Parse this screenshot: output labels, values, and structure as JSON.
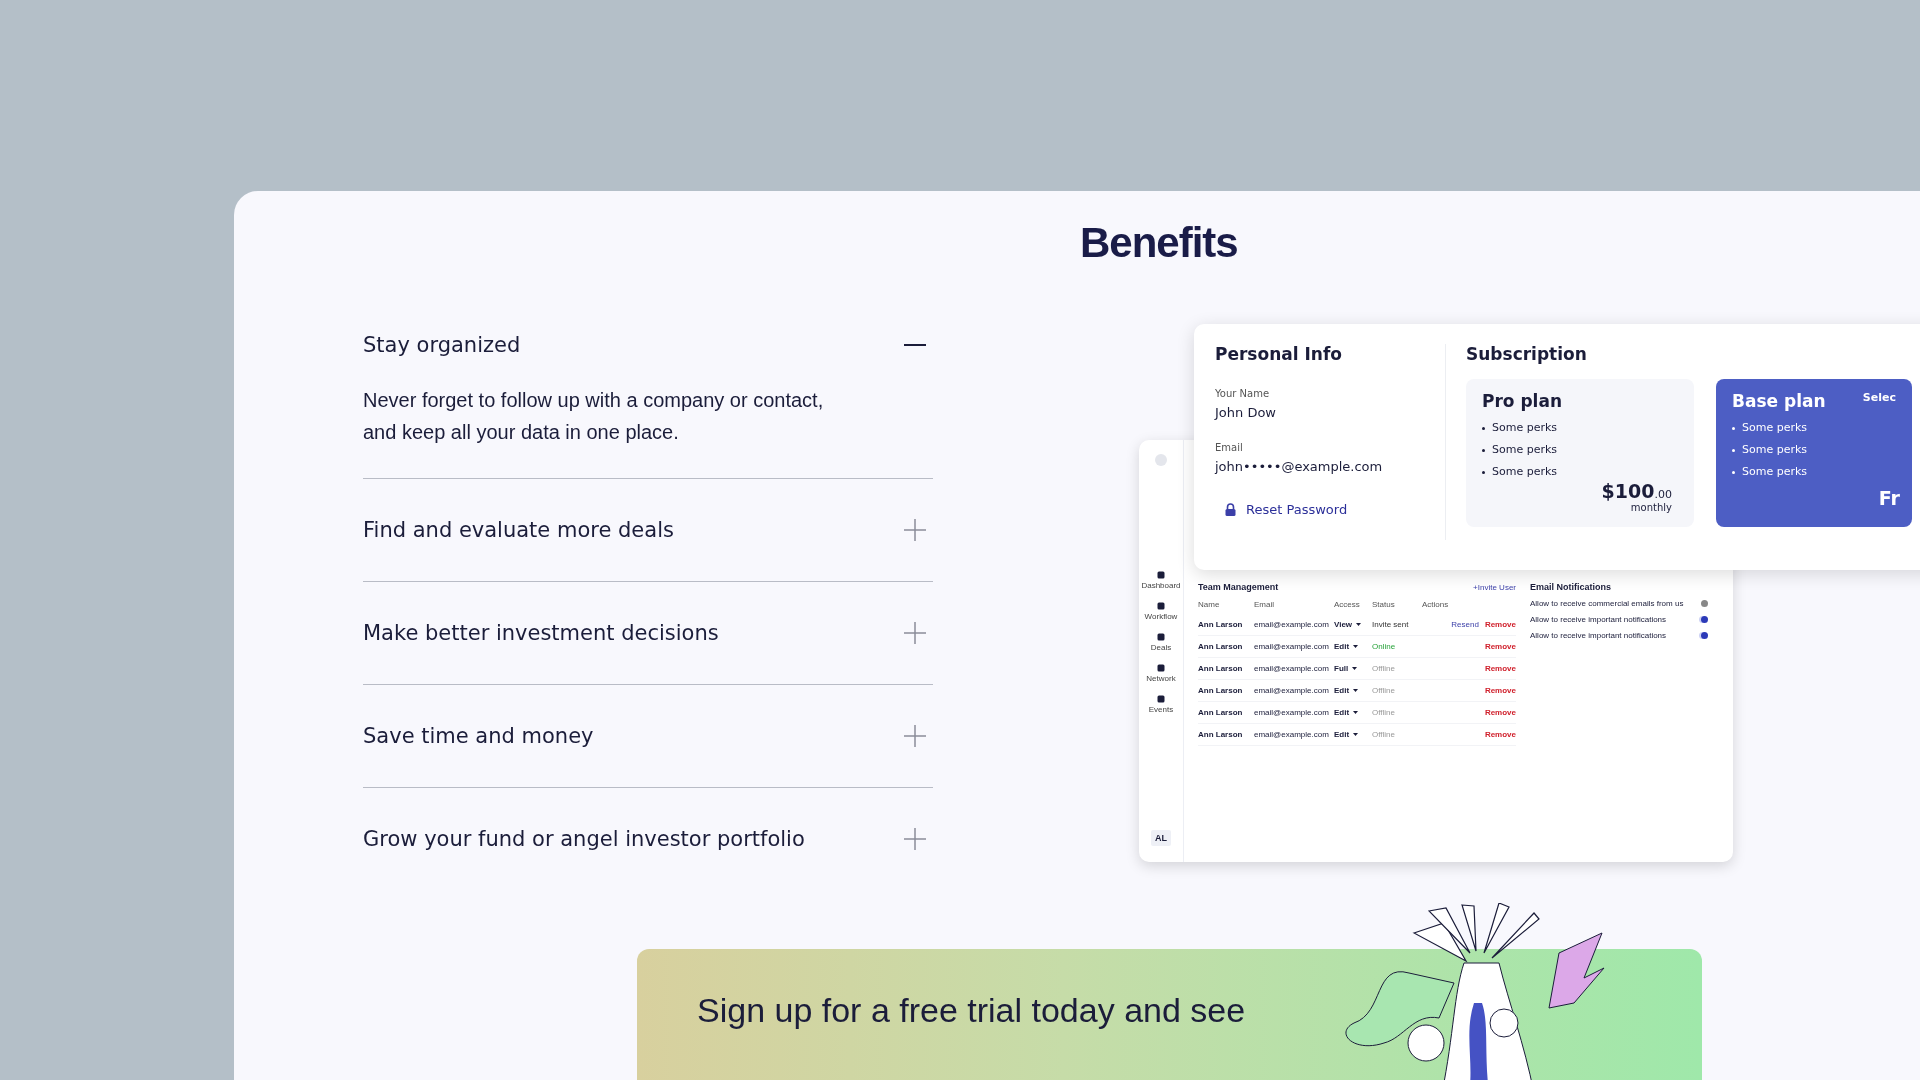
{
  "title": "Benefits",
  "accordion": [
    {
      "title": "Stay organized",
      "expanded": true,
      "body": "Never forget to follow up with a company or contact, and keep all your data in one place."
    },
    {
      "title": "Find and evaluate more deals",
      "expanded": false
    },
    {
      "title": "Make better investment decisions",
      "expanded": false
    },
    {
      "title": "Save time and money",
      "expanded": false
    },
    {
      "title": "Grow your fund or angel investor portfolio",
      "expanded": false
    }
  ],
  "preview": {
    "sidebar": [
      {
        "label": "Dashboard"
      },
      {
        "label": "Workflow"
      },
      {
        "label": "Deals"
      },
      {
        "label": "Network"
      },
      {
        "label": "Events"
      }
    ],
    "avatar": "AL",
    "team": {
      "title": "Team Management",
      "invite": "+Invite User",
      "columns": [
        "Name",
        "Email",
        "Access",
        "Status",
        "Actions"
      ],
      "rows": [
        {
          "name": "Ann Larson",
          "email": "email@example.com",
          "access": "View",
          "status": "Invite sent",
          "kind": "invite",
          "resend": "Resend",
          "remove": "Remove"
        },
        {
          "name": "Ann Larson",
          "email": "email@example.com",
          "access": "Edit",
          "status": "Online",
          "kind": "online",
          "remove": "Remove"
        },
        {
          "name": "Ann Larson",
          "email": "email@example.com",
          "access": "Full",
          "status": "Offline",
          "kind": "offline",
          "remove": "Remove"
        },
        {
          "name": "Ann Larson",
          "email": "email@example.com",
          "access": "Edit",
          "status": "Offline",
          "kind": "offline",
          "remove": "Remove"
        },
        {
          "name": "Ann Larson",
          "email": "email@example.com",
          "access": "Edit",
          "status": "Offline",
          "kind": "offline",
          "remove": "Remove"
        },
        {
          "name": "Ann Larson",
          "email": "email@example.com",
          "access": "Edit",
          "status": "Offline",
          "kind": "offline",
          "remove": "Remove"
        }
      ]
    },
    "notifications": {
      "title": "Email Notifications",
      "items": [
        {
          "label": "Allow to receive commercial emails from us",
          "on": false
        },
        {
          "label": "Allow to receive important notifications",
          "on": true
        },
        {
          "label": "Allow to receive important notifications",
          "on": true
        }
      ]
    },
    "personal": {
      "title": "Personal Info",
      "fields": [
        {
          "label": "Your Name",
          "value": "John Dow"
        },
        {
          "label": "Email",
          "value": "john•••••@example.com"
        }
      ],
      "reset": "Reset Password"
    },
    "subscription": {
      "title": "Subscription",
      "plans": [
        {
          "name": "Pro plan",
          "selected": false,
          "perks": [
            "Some perks",
            "Some perks",
            "Some perks"
          ],
          "price": "$100",
          "cents": ".00",
          "period": "monthly"
        },
        {
          "name": "Base plan",
          "selected": true,
          "badge": "Selec",
          "perks": [
            "Some perks",
            "Some perks",
            "Some perks"
          ],
          "price": "Fr"
        }
      ]
    }
  },
  "banner": {
    "text": "Sign up for a free trial today and see"
  }
}
